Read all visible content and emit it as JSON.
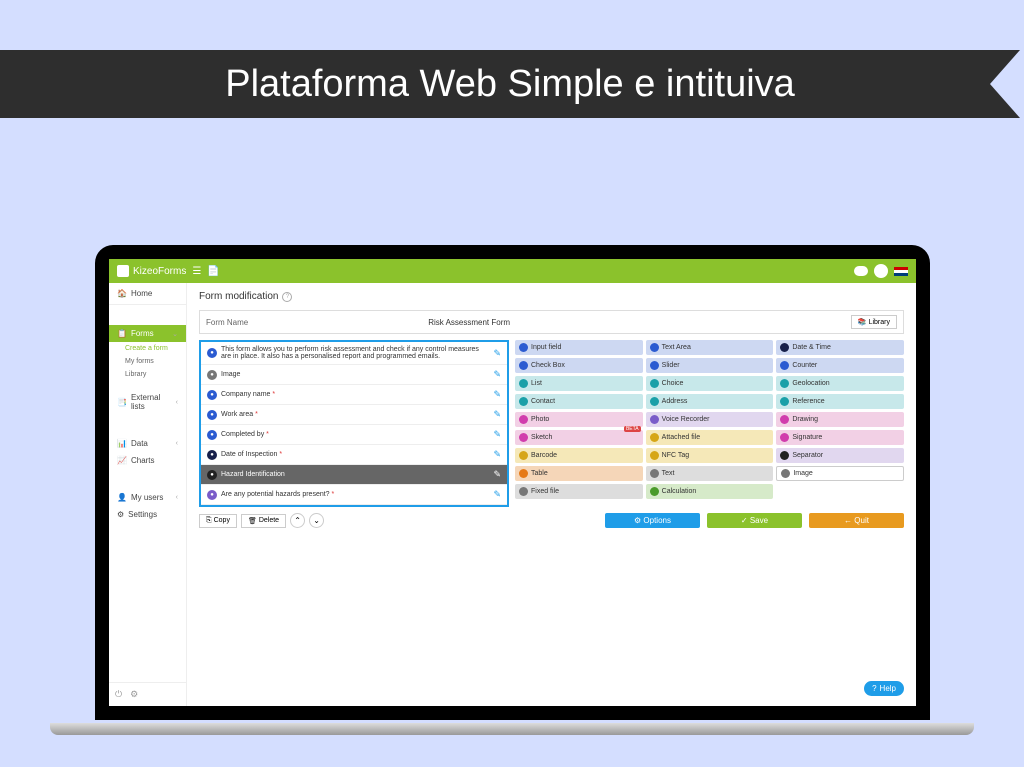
{
  "banner": "Plataforma Web Simple e intituiva",
  "brand": "KizeoForms",
  "sidebar": {
    "home": "Home",
    "forms": "Forms",
    "createForm": "Create a form",
    "myForms": "My forms",
    "library": "Library",
    "externalLists": "External lists",
    "data": "Data",
    "charts": "Charts",
    "myUsers": "My users",
    "settings": "Settings"
  },
  "pageTitle": "Form modification",
  "formNameLabel": "Form Name",
  "formNameValue": "Risk Assessment Form",
  "libraryBtn": "Library",
  "fields": [
    {
      "label": "This form allows you to perform risk assessment and check if any control measures are in place. It also has a personalised report and programmed emails.",
      "icon": "i-blue",
      "req": false
    },
    {
      "label": "Image",
      "icon": "i-grey",
      "req": false
    },
    {
      "label": "Company name",
      "icon": "i-blue",
      "req": true
    },
    {
      "label": "Work area",
      "icon": "i-blue",
      "req": true
    },
    {
      "label": "Completed by",
      "icon": "i-blue",
      "req": true
    },
    {
      "label": "Date of Inspection",
      "icon": "i-dkblue",
      "req": true
    },
    {
      "label": "Hazard Identification",
      "icon": "i-black",
      "req": false,
      "dark": true
    },
    {
      "label": "Are any potential hazards present?",
      "icon": "i-lav",
      "req": true
    }
  ],
  "palette": [
    {
      "label": "Input field",
      "bg": "c-blue",
      "i": "i-blue"
    },
    {
      "label": "Text Area",
      "bg": "c-blue",
      "i": "i-blue"
    },
    {
      "label": "Date & Time",
      "bg": "c-blue",
      "i": "i-dkblue"
    },
    {
      "label": "Check Box",
      "bg": "c-blue",
      "i": "i-blue"
    },
    {
      "label": "Slider",
      "bg": "c-blue",
      "i": "i-blue"
    },
    {
      "label": "Counter",
      "bg": "c-blue",
      "i": "i-blue"
    },
    {
      "label": "List",
      "bg": "c-teal",
      "i": "i-teal"
    },
    {
      "label": "Choice",
      "bg": "c-teal",
      "i": "i-teal"
    },
    {
      "label": "Geolocation",
      "bg": "c-teal",
      "i": "i-teal"
    },
    {
      "label": "Contact",
      "bg": "c-teal",
      "i": "i-teal"
    },
    {
      "label": "Address",
      "bg": "c-teal",
      "i": "i-teal"
    },
    {
      "label": "Reference",
      "bg": "c-teal",
      "i": "i-teal"
    },
    {
      "label": "Photo",
      "bg": "c-pink",
      "i": "i-pink"
    },
    {
      "label": "Voice Recorder",
      "bg": "c-lav",
      "i": "i-lav"
    },
    {
      "label": "Drawing",
      "bg": "c-pink",
      "i": "i-pink"
    },
    {
      "label": "Sketch",
      "bg": "c-pink",
      "i": "i-pink",
      "beta": "BETA"
    },
    {
      "label": "Attached file",
      "bg": "c-yellow",
      "i": "i-yellow"
    },
    {
      "label": "Signature",
      "bg": "c-pink",
      "i": "i-pink"
    },
    {
      "label": "Barcode",
      "bg": "c-yellow",
      "i": "i-yellow"
    },
    {
      "label": "NFC Tag",
      "bg": "c-yellow",
      "i": "i-yellow"
    },
    {
      "label": "Separator",
      "bg": "c-lav",
      "i": "i-black"
    },
    {
      "label": "Table",
      "bg": "c-orange",
      "i": "i-orange"
    },
    {
      "label": "Text",
      "bg": "c-grey",
      "i": "i-grey"
    },
    {
      "label": "Image",
      "bg": "imgtype",
      "i": "i-grey"
    },
    {
      "label": "Fixed file",
      "bg": "c-grey",
      "i": "i-grey"
    },
    {
      "label": "Calculation",
      "bg": "c-green",
      "i": "i-green"
    }
  ],
  "actions": {
    "copy": "Copy",
    "delete": "Delete",
    "options": "Options",
    "save": "Save",
    "quit": "Quit"
  },
  "helpBtn": "Help"
}
